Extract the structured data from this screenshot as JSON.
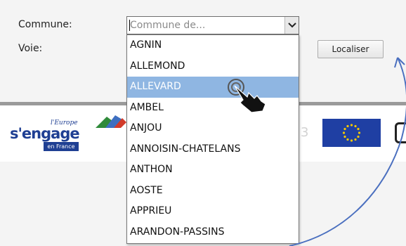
{
  "form": {
    "commune_label": "Commune:",
    "voie_label": "Voie:",
    "commune_placeholder": "Commune de...",
    "localize_button": "Localiser"
  },
  "dropdown": {
    "items": [
      "AGNIN",
      "ALLEMOND",
      "ALLEVARD",
      "AMBEL",
      "ANJOU",
      "ANNOISIN-CHATELANS",
      "ANTHON",
      "AOSTE",
      "APPRIEU",
      "ARANDON-PASSINS"
    ],
    "selected_index": 2
  },
  "logos": {
    "europe_tag": "l'Europe",
    "europe_word": "s'engage",
    "europe_region": "en France"
  },
  "colors": {
    "selection": "#8fb6e2",
    "eu_blue": "#1f3fa3",
    "eu_star": "#f3c800",
    "annotation_arrow": "#4a6fbf"
  },
  "icons": [
    "chevron-down-icon",
    "pointer-hand-icon",
    "eu-flag-icon",
    "annotation-arrow-icon"
  ]
}
